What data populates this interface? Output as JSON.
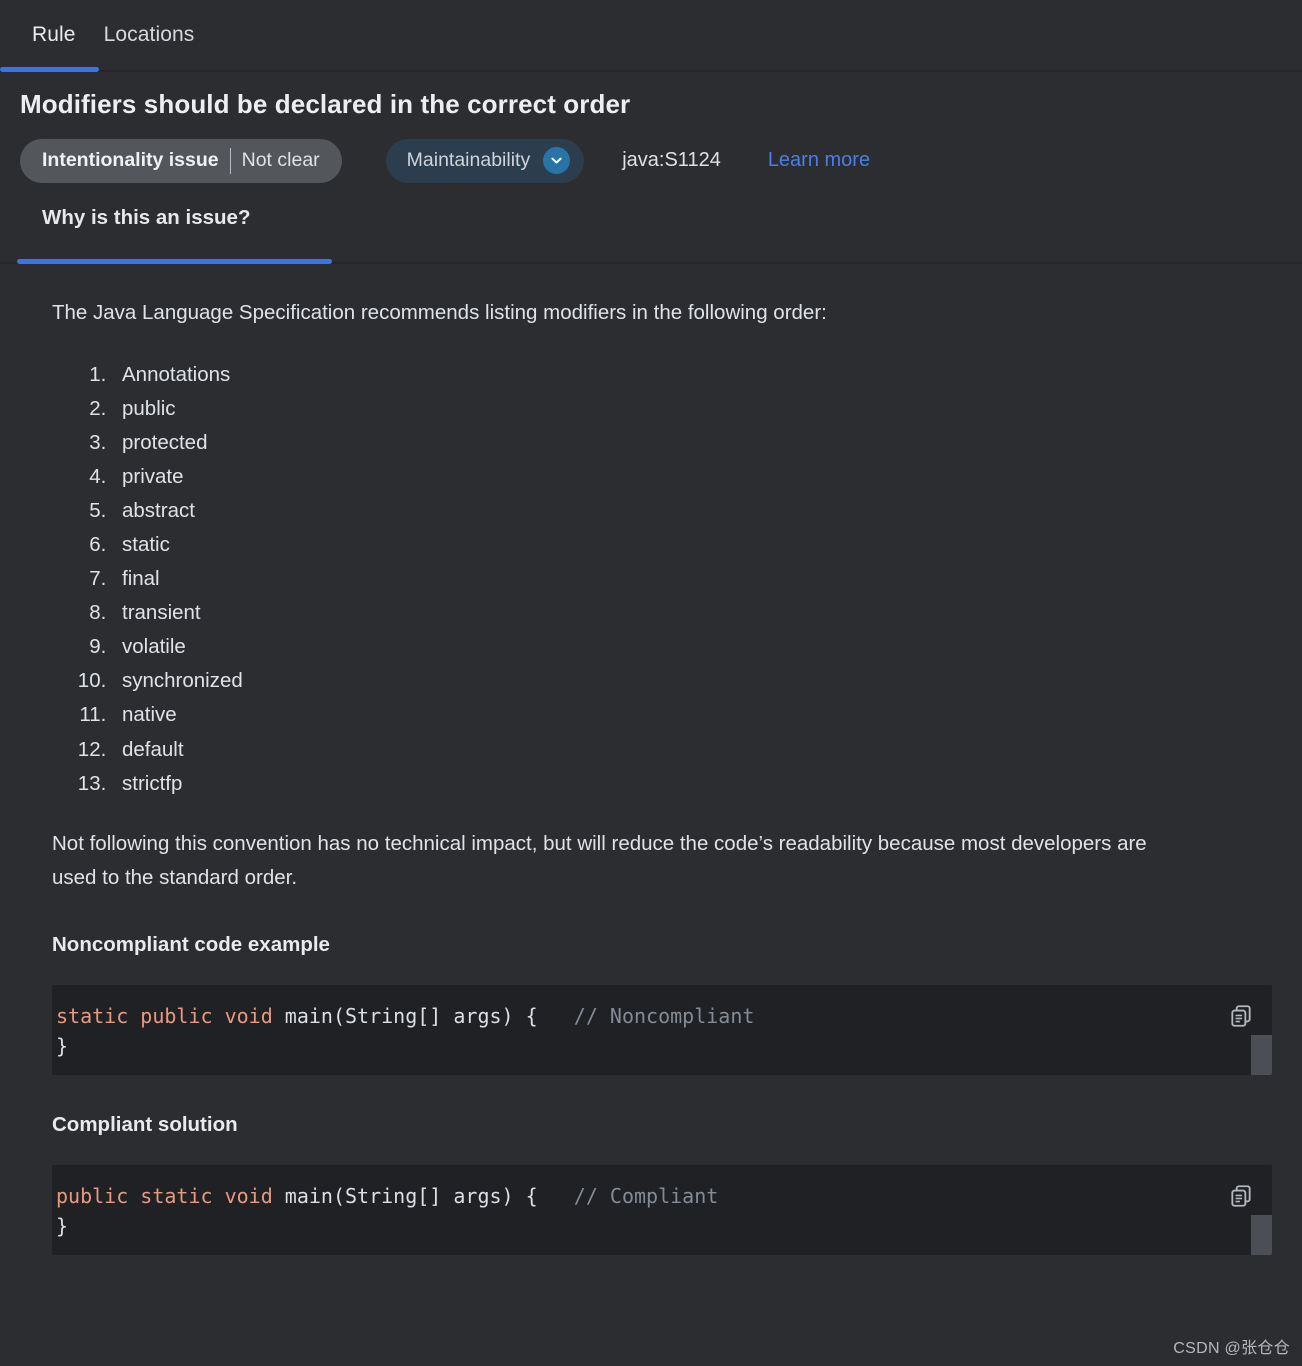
{
  "tabs": {
    "items": [
      {
        "id": "rule",
        "label": "Rule",
        "active": true
      },
      {
        "id": "locations",
        "label": "Locations",
        "active": false
      }
    ]
  },
  "header": {
    "title": "Modifiers should be declared in the correct order",
    "impact_chip": {
      "primary": "Intentionality issue",
      "separator": "|",
      "secondary": "Not clear"
    },
    "quality_chip": {
      "label": "Maintainability",
      "icon": "chevron-down-icon"
    },
    "rule_key": "java:S1124",
    "learn_more": "Learn more"
  },
  "subtabs": {
    "items": [
      {
        "id": "why",
        "label": "Why is this an issue?",
        "active": true
      }
    ]
  },
  "content": {
    "intro_paragraph": "The Java Language Specification recommends listing modifiers in the following order:",
    "modifier_list": [
      "Annotations",
      "public",
      "protected",
      "private",
      "abstract",
      "static",
      "final",
      "transient",
      "volatile",
      "synchronized",
      "native",
      "default",
      "strictfp"
    ],
    "closing_paragraph": "Not following this convention has no technical impact, but will reduce the code’s readability because most developers are used to the standard order.",
    "noncompliant": {
      "heading": "Noncompliant code example",
      "keywords": "static public void",
      "signature": " main(String[] args) {",
      "comment": "// Noncompliant",
      "closing_brace": "}",
      "copy_icon": "copy-icon"
    },
    "compliant": {
      "heading": "Compliant solution",
      "keywords": "public static void",
      "signature": " main(String[] args) {",
      "comment": "// Compliant",
      "closing_brace": "}",
      "copy_icon": "copy-icon"
    }
  },
  "watermark": "CSDN @张仓仓",
  "colors": {
    "background": "#2b2d31",
    "accent_blue": "#3b73e8",
    "link_blue": "#4a7fe8",
    "code_background": "#1f2125",
    "keyword_orange": "#e99a7e",
    "comment_gray": "#848b95",
    "quality_chip_bg": "#2c3d4d",
    "impact_chip_bg": "#53565b",
    "chevron_badge": "#2874a6"
  }
}
